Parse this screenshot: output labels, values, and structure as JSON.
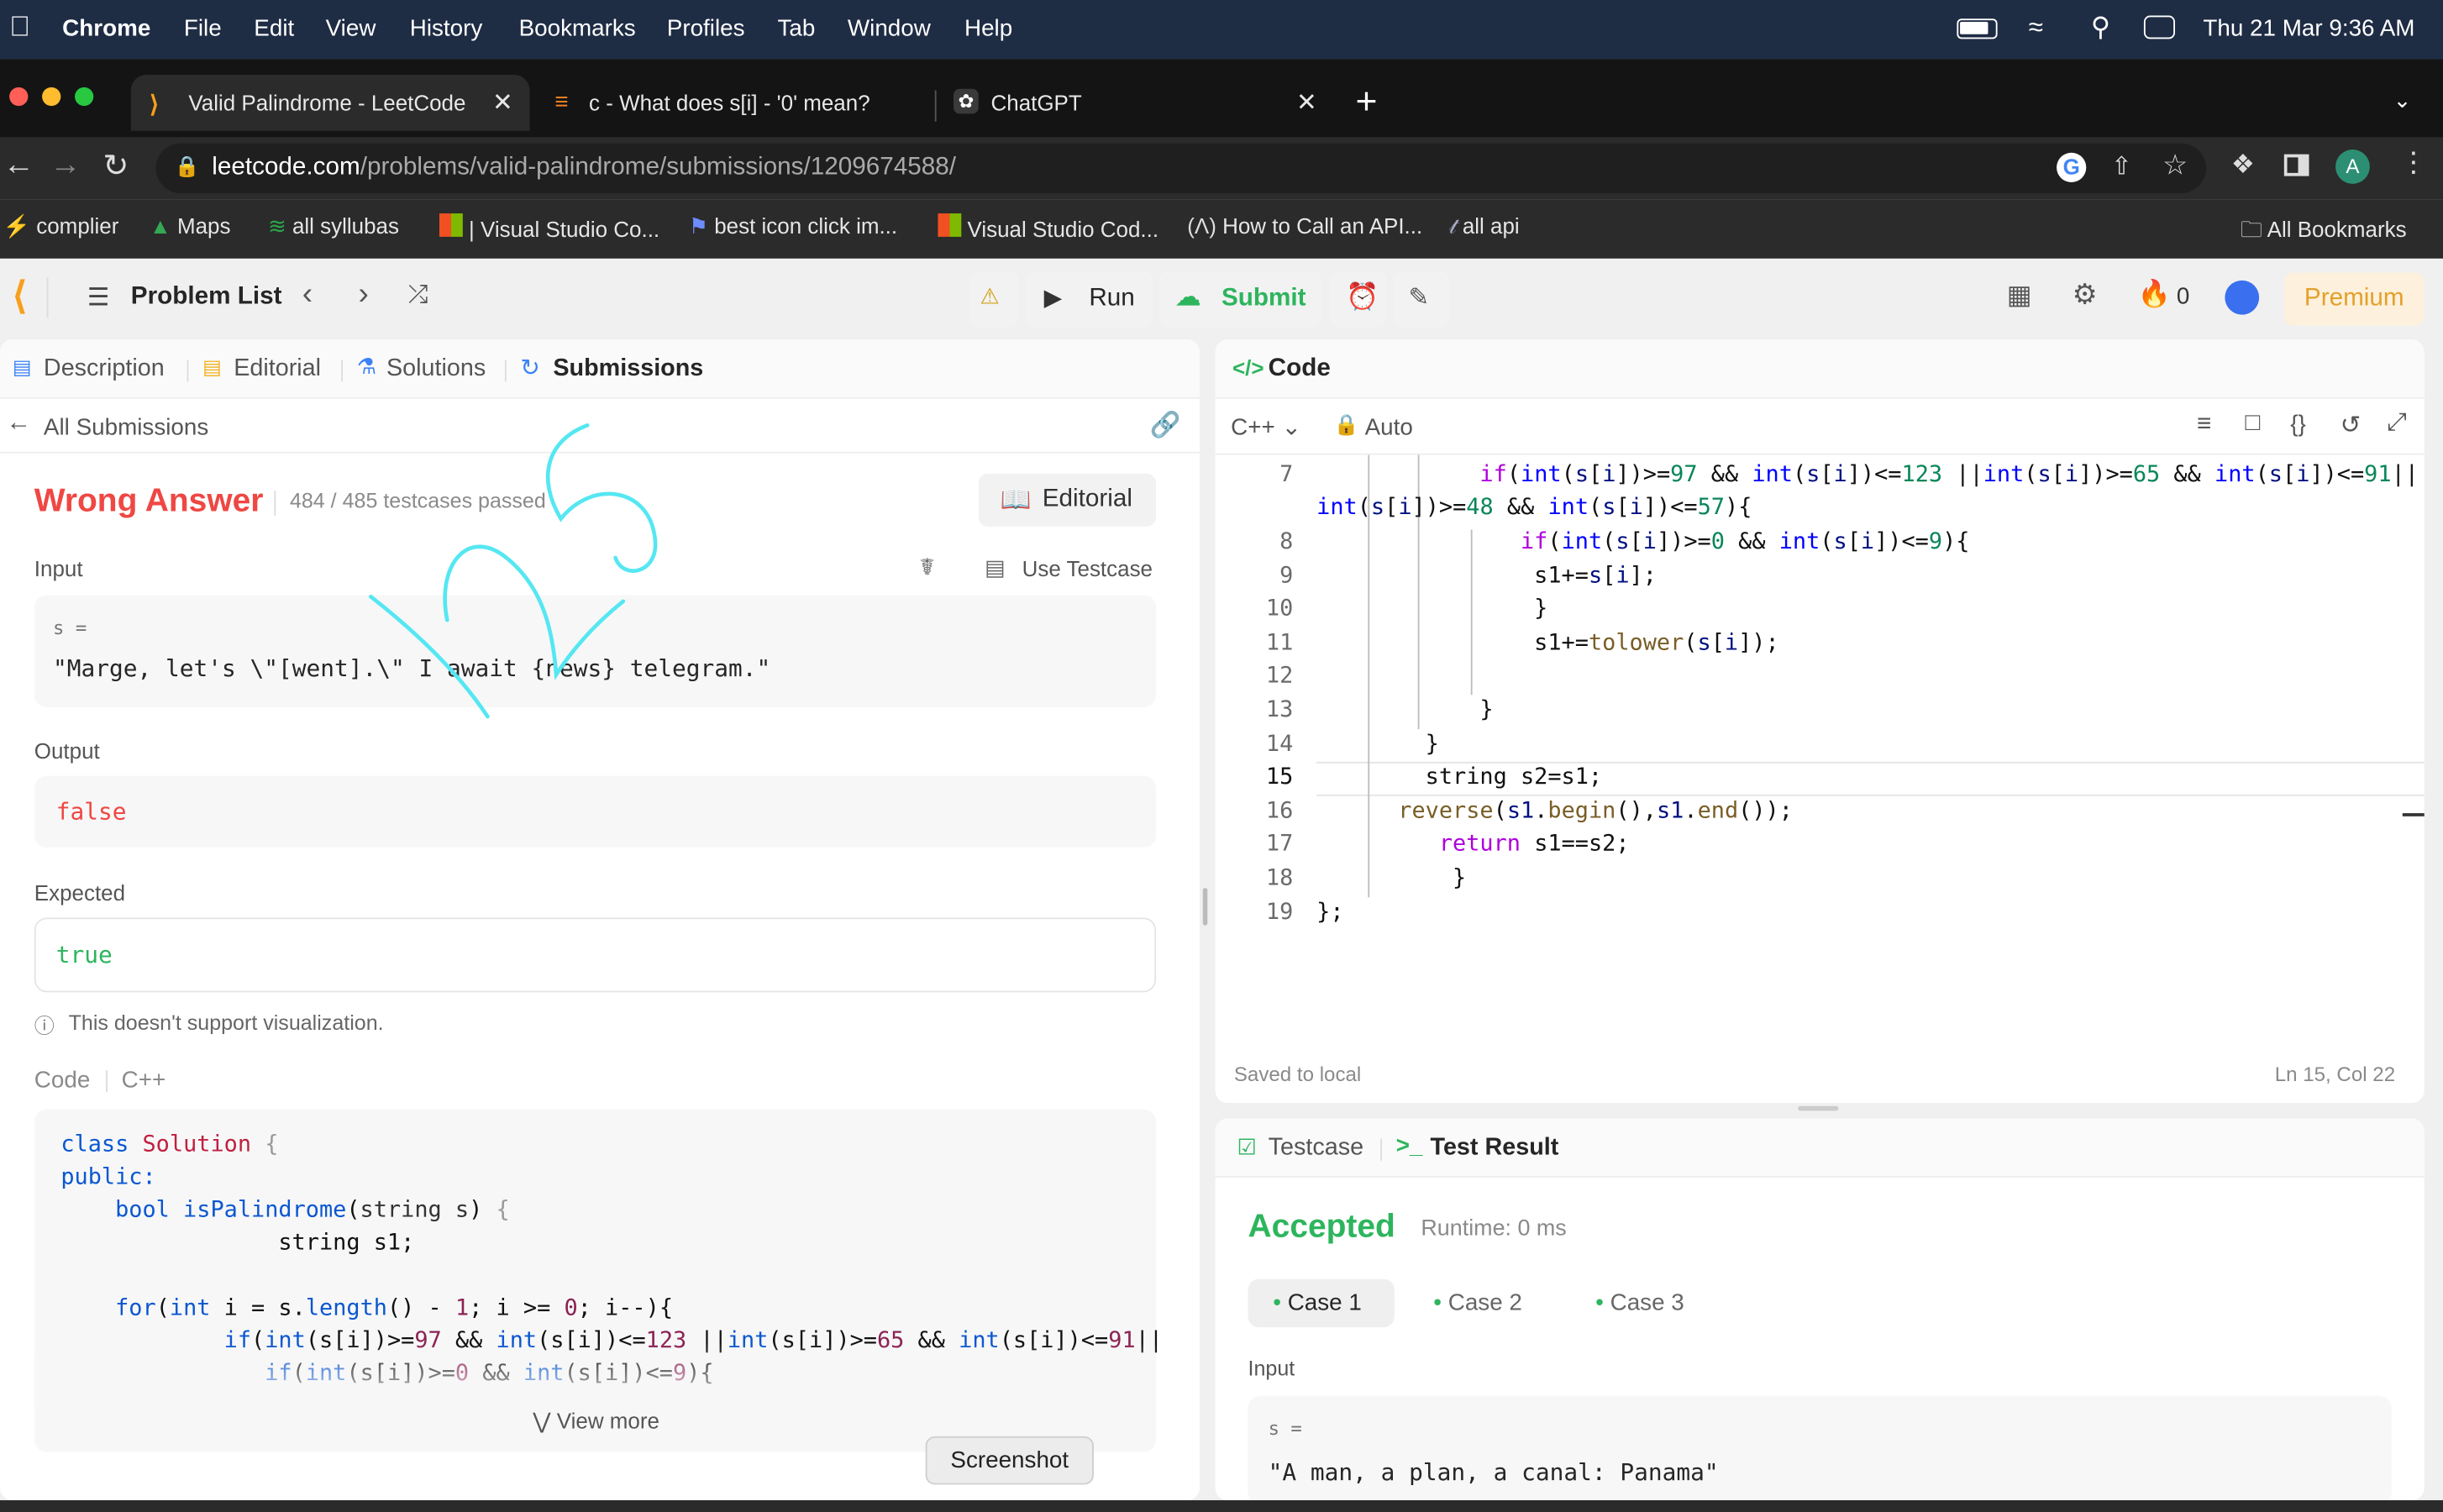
{
  "menubar": {
    "app": "Chrome",
    "items": [
      "File",
      "Edit",
      "View",
      "History",
      "Bookmarks",
      "Profiles",
      "Tab",
      "Window",
      "Help"
    ],
    "clock": "Thu 21 Mar  9:36 AM"
  },
  "tabs": [
    {
      "title": "Valid Palindrome - LeetCode",
      "active": true
    },
    {
      "title": "c - What does s[i] - '0' mean?",
      "active": false
    },
    {
      "title": "ChatGPT",
      "active": false
    }
  ],
  "address": {
    "domain": "leetcode.com",
    "path": "/problems/valid-palindrome/submissions/1209674588/",
    "profile_initial": "A"
  },
  "bookmarks": [
    "complier",
    "Maps",
    "all syllubas",
    "| Visual Studio Co...",
    "best icon click im...",
    "Visual Studio Cod...",
    "How to Call an API...",
    "all api"
  ],
  "bookmarks_all": "All Bookmarks",
  "lcnav": {
    "problem_list": "Problem List",
    "run": "Run",
    "submit": "Submit",
    "streak": "0",
    "premium": "Premium"
  },
  "left": {
    "tabs": [
      "Description",
      "Editorial",
      "Solutions",
      "Submissions"
    ],
    "back": "All Submissions",
    "status": "Wrong Answer",
    "passed": "484 / 485 testcases passed",
    "editorial_btn": "Editorial",
    "input_label": "Input",
    "use_testcase": "Use Testcase",
    "var": "s =",
    "input_value": "\"Marge, let's \\\"[went].\\\" I await {news} telegram.\"",
    "output_label": "Output",
    "output_value": "false",
    "expected_label": "Expected",
    "expected_value": "true",
    "viz_note": "This doesn't support visualization.",
    "code_label": "Code",
    "lang": "C++",
    "view_more": "View more"
  },
  "editor": {
    "title": "Code",
    "lang": "C++",
    "auto": "Auto",
    "saved": "Saved to local",
    "cursor": "Ln 15, Col 22",
    "lines": [
      "7",
      "8",
      "9",
      "10",
      "11",
      "12",
      "13",
      "14",
      "15",
      "16",
      "17",
      "18",
      "19"
    ]
  },
  "test": {
    "tab1": "Testcase",
    "tab2": "Test Result",
    "status": "Accepted",
    "runtime": "Runtime: 0 ms",
    "cases": [
      "Case 1",
      "Case 2",
      "Case 3"
    ],
    "input_label": "Input",
    "var": "s =",
    "input_value": "\"A man, a plan, a canal: Panama\""
  },
  "tooltip": "Screenshot"
}
